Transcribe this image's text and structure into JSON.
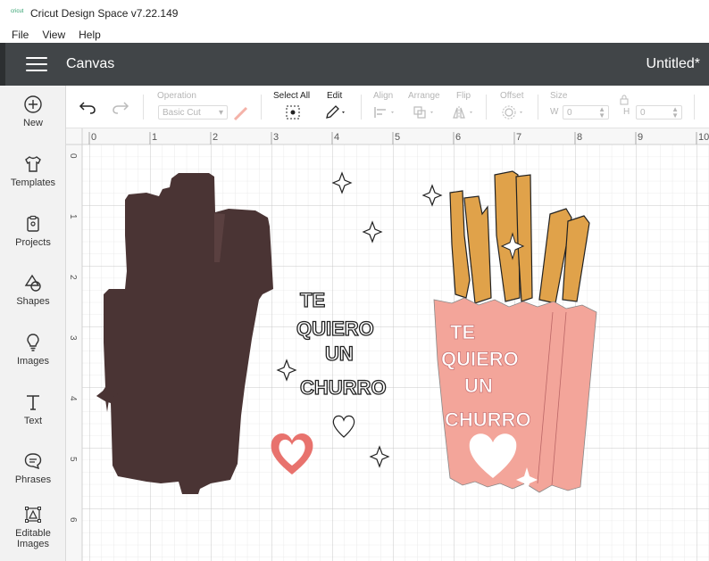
{
  "app": {
    "logo_text": "cricut",
    "window_title": "Cricut Design Space  v7.22.149"
  },
  "menu": [
    "File",
    "View",
    "Help"
  ],
  "header": {
    "section": "Canvas",
    "project_name": "Untitled*"
  },
  "sidebar": {
    "items": [
      {
        "label": "New",
        "icon": "plus-circle-icon"
      },
      {
        "label": "Templates",
        "icon": "tshirt-icon"
      },
      {
        "label": "Projects",
        "icon": "clipboard-icon"
      },
      {
        "label": "Shapes",
        "icon": "shapes-icon"
      },
      {
        "label": "Images",
        "icon": "lightbulb-icon"
      },
      {
        "label": "Text",
        "icon": "text-t-icon"
      },
      {
        "label": "Phrases",
        "icon": "speech-bubble-icon"
      },
      {
        "label": "Editable",
        "label2": "Images",
        "icon": "editable-images-icon"
      }
    ]
  },
  "toolbar": {
    "operation_label": "Operation",
    "operation_value": "Basic Cut",
    "select_all_label": "Select All",
    "edit_label": "Edit",
    "align_label": "Align",
    "arrange_label": "Arrange",
    "flip_label": "Flip",
    "offset_label": "Offset",
    "size_label": "Size",
    "w_label": "W",
    "h_label": "H",
    "w_value": "0",
    "h_value": "0"
  },
  "ruler": {
    "h_ticks": [
      "0",
      "1",
      "2",
      "3",
      "4",
      "5",
      "6",
      "7",
      "8",
      "9",
      "10"
    ],
    "v_ticks": [
      "0",
      "1",
      "2",
      "3",
      "4",
      "5",
      "6"
    ]
  },
  "design": {
    "text_lines": [
      "TE",
      "QUIERO",
      "UN",
      "CHURRO"
    ],
    "colors": {
      "hand": "#4a3434",
      "churro": "#e0a24a",
      "cup": "#f3a59a",
      "heart": "#e8726d",
      "grid": "#dcdcdc",
      "header_bg": "#414548"
    }
  }
}
